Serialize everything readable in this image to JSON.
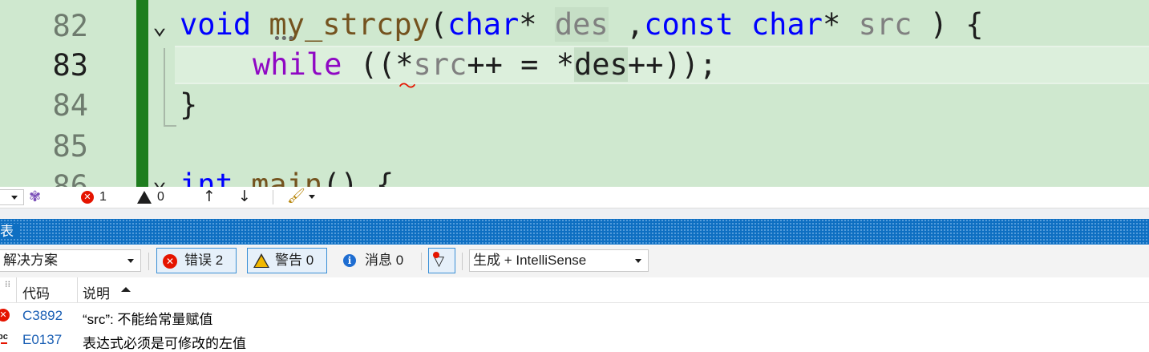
{
  "editor": {
    "line_numbers": [
      "82",
      "83",
      "84",
      "85",
      "86"
    ],
    "lines": {
      "l82": {
        "kw_void": "void",
        "fn_name": "my_strcpy",
        "open_paren": "(",
        "kw_char1": "char",
        "star1": "*",
        "param_des": "des",
        "comma": ",",
        "kw_const": "const",
        "kw_char2": "char",
        "star2": "*",
        "param_src": "src",
        "close": ") {"
      },
      "l83": {
        "kw_while": "while",
        "p1": "((",
        "star_src": "*",
        "src_name": "src",
        "op1": "++ = *",
        "des_name": "des",
        "op2": "++));"
      },
      "l84": {
        "brace": "}"
      },
      "l86": {
        "kw_int": "int",
        "fn_main": "main",
        "rest": "() {"
      }
    },
    "colors": {
      "background": "#cfe8cf",
      "keyword": "#0000ff",
      "function": "#74531f",
      "param": "#808080",
      "control": "#8f08c4",
      "change_bar": "#1e7d1e"
    }
  },
  "strip": {
    "errors_count": "1",
    "warnings_count": "0",
    "icons": [
      "dropdown-icon",
      "copilot-icon",
      "error-icon",
      "warning-icon",
      "up-arrow-icon",
      "down-arrow-icon",
      "brush-icon"
    ]
  },
  "panel": {
    "title": "表",
    "scope_value": "解决方案",
    "errors_btn": "错误 2",
    "warnings_btn": "警告 0",
    "messages_btn": "消息 0",
    "source_value": "生成 + IntelliSense",
    "col_code": "代码",
    "col_desc": "说明",
    "rows": [
      {
        "code": "C3892",
        "desc": "“src”: 不能给常量赋值",
        "icon": "error-icon"
      },
      {
        "code": "E0137",
        "desc": "表达式必须是可修改的左值",
        "icon": "intellisense-icon"
      }
    ],
    "colors": {
      "title_bar": "#0e6fc2",
      "link": "#1a5fb4",
      "error": "#e51400"
    }
  }
}
